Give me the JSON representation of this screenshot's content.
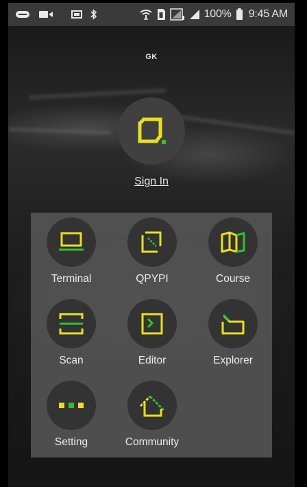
{
  "status_bar": {
    "battery_text": "100%",
    "time": "9:45 AM",
    "left_icons": [
      "message-icon",
      "video-icon",
      "cast-icon",
      "bluetooth-icon"
    ],
    "right_icons": [
      "wifi-icon",
      "sim-icon",
      "signal-icon",
      "battery-icon"
    ]
  },
  "header": {
    "mark_text": "GK"
  },
  "signin": {
    "label": "Sign In",
    "avatar_icon": "app-logo-icon"
  },
  "menu": {
    "items": [
      {
        "label": "Terminal",
        "icon": "terminal-icon"
      },
      {
        "label": "QPYPI",
        "icon": "qpypi-icon"
      },
      {
        "label": "Course",
        "icon": "course-icon"
      },
      {
        "label": "Scan",
        "icon": "scan-icon"
      },
      {
        "label": "Editor",
        "icon": "editor-icon"
      },
      {
        "label": "Explorer",
        "icon": "explorer-icon"
      },
      {
        "label": "Setting",
        "icon": "setting-icon"
      },
      {
        "label": "Community",
        "icon": "community-icon"
      }
    ]
  },
  "colors": {
    "accent_yellow": "#e8e020",
    "accent_green": "#30c030",
    "circle_bg": "#333333",
    "panel_bg": "#5a5a5a",
    "status_bar_bg": "#3a3a3a"
  }
}
